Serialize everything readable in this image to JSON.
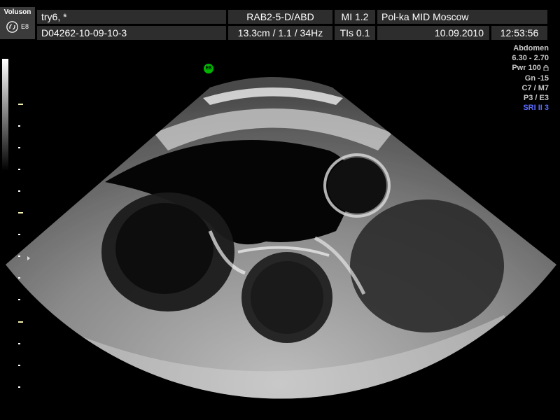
{
  "header": {
    "brand": "Voluson",
    "model": "E8",
    "logo_icon": "ge-logo-icon",
    "patient_name": "try6,  *",
    "patient_id": "D04262-10-09-10-3",
    "probe": "RAB2-5-D/ABD",
    "scan_params": "13.3cm / 1.1 / 34Hz",
    "mi": "MI  1.2",
    "tis": "TIs  0.1",
    "institution": "Pol-ka MID Moscow",
    "date": "10.09.2010",
    "time": "12:53:56"
  },
  "params": {
    "preset": "Abdomen",
    "frequency": "6.30 - 2.70",
    "power": "Pwr 100",
    "gain": "Gn -15",
    "mode": "C7 / M7",
    "persistence": "P3 / E3",
    "sri": "SRI II 3",
    "lock_icon": "lock-icon"
  },
  "probe_badge": "E8",
  "colors": {
    "header_cell": "#2d2d2d",
    "param_text": "#c8c8c8",
    "sri_text": "#5a6cff",
    "probe_badge": "#00b400",
    "scale_tick": "#f4f1b0"
  }
}
